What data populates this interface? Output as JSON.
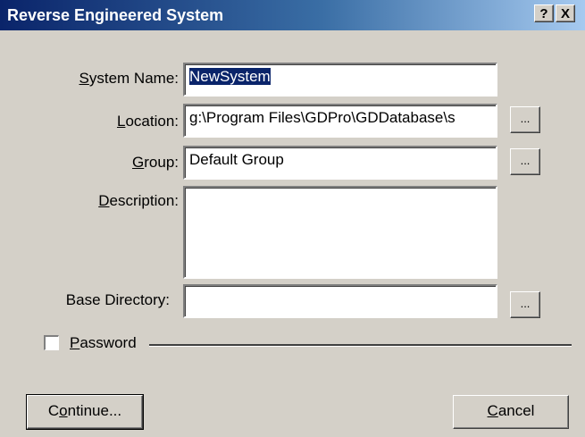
{
  "window": {
    "title": "Reverse Engineered System",
    "help_label": "?",
    "close_label": "X"
  },
  "form": {
    "system_name": {
      "label_accel": "S",
      "label_rest": "ystem Name:",
      "value": "NewSystem"
    },
    "location": {
      "label_accel": "L",
      "label_rest": "ocation:",
      "value": "g:\\Program Files\\GDPro\\GDDatabase\\s",
      "browse_label": "..."
    },
    "group": {
      "label_accel": "G",
      "label_rest": "roup:",
      "value": "Default Group",
      "browse_label": "..."
    },
    "description": {
      "label_accel": "D",
      "label_rest": "escription:",
      "value": ""
    },
    "base_directory": {
      "label": "Base Directory:",
      "value": "",
      "browse_label": "..."
    },
    "password": {
      "label_accel": "P",
      "label_rest": "assword",
      "checked": false
    }
  },
  "buttons": {
    "continue": {
      "label_pre": "C",
      "label_accel": "o",
      "label_rest": "ntinue..."
    },
    "cancel": {
      "label_accel": "C",
      "label_rest": "ancel"
    }
  }
}
